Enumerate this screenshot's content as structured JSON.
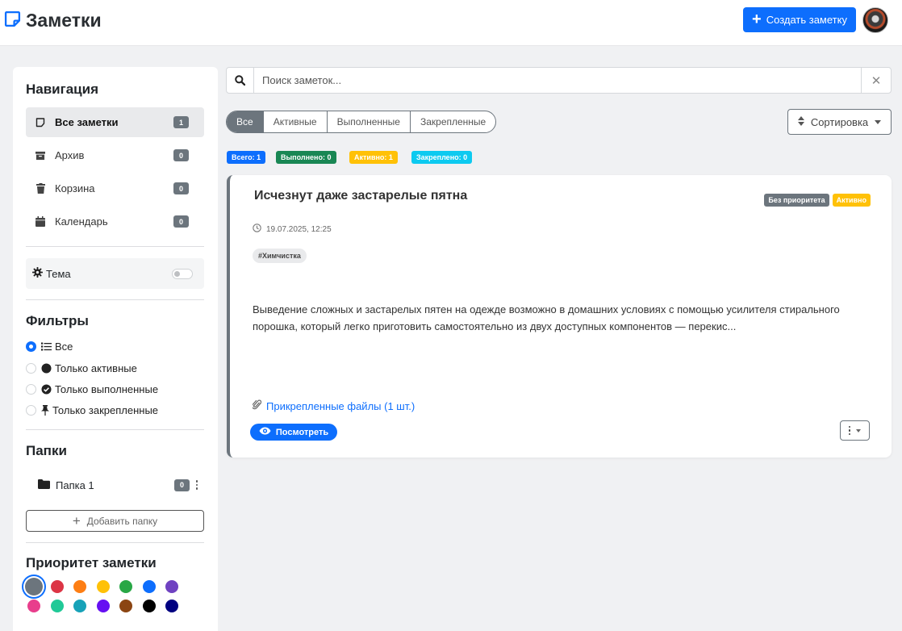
{
  "header": {
    "title": "Заметки",
    "create_label": "Создать заметку",
    "accent_color": "#0d6efd"
  },
  "sidebar": {
    "nav_title": "Навигация",
    "nav_items": [
      {
        "label": "Все заметки",
        "count": "1",
        "icon": "note-icon"
      },
      {
        "label": "Архив",
        "count": "0",
        "icon": "archive-icon"
      },
      {
        "label": "Корзина",
        "count": "0",
        "icon": "trash-icon"
      },
      {
        "label": "Календарь",
        "count": "0",
        "icon": "calendar-icon"
      }
    ],
    "theme_label": "Тема",
    "filters_title": "Фильтры",
    "filters": [
      {
        "label": "Все",
        "icon": "list-icon",
        "checked": true
      },
      {
        "label": "Только активные",
        "icon": "circle-icon",
        "checked": false
      },
      {
        "label": "Только выполненные",
        "icon": "check-circle-icon",
        "checked": false
      },
      {
        "label": "Только закрепленные",
        "icon": "pin-icon",
        "checked": false
      }
    ],
    "folders_title": "Папки",
    "folders": [
      {
        "label": "Папка 1",
        "count": "0"
      }
    ],
    "add_folder_label": "Добавить папку",
    "priority_title": "Приоритет заметки",
    "priority_colors": [
      "#6c757d",
      "#dc3545",
      "#fd7e14",
      "#ffc107",
      "#28a745",
      "#0d6efd",
      "#6f42c1",
      "#e83e8c",
      "#20c997",
      "#17a2b8",
      "#6610f2",
      "#8b4513",
      "#000000",
      "#000080"
    ]
  },
  "search": {
    "placeholder": "Поиск заметок..."
  },
  "tabs": [
    "Все",
    "Активные",
    "Выполненные",
    "Закрепленные"
  ],
  "sort_label": "Сортировка",
  "stats": [
    {
      "label": "Всего: 1",
      "color": "#0d6efd"
    },
    {
      "label": "Выполнено: 0",
      "color": "#198754"
    },
    {
      "label": "Активно: 1",
      "color": "#ffc107"
    },
    {
      "label": "Закреплено: 0",
      "color": "#0dcaf0"
    }
  ],
  "note": {
    "title": "Исчезнут даже застарелые пятна",
    "priority_badge": "Без приоритета",
    "status_badge": "Активно",
    "date": "19.07.2025, 12:25",
    "tag": "#Химчистка",
    "description": "Выведение сложных и застарелых пятен на одежде возможно в домашних условиях с помощью усилителя стирального порошка, который легко приготовить самостоятельно из двух доступных компонентов — перекис...",
    "attachments": "Прикрепленные файлы (1 шт.)",
    "view_label": "Посмотреть"
  }
}
